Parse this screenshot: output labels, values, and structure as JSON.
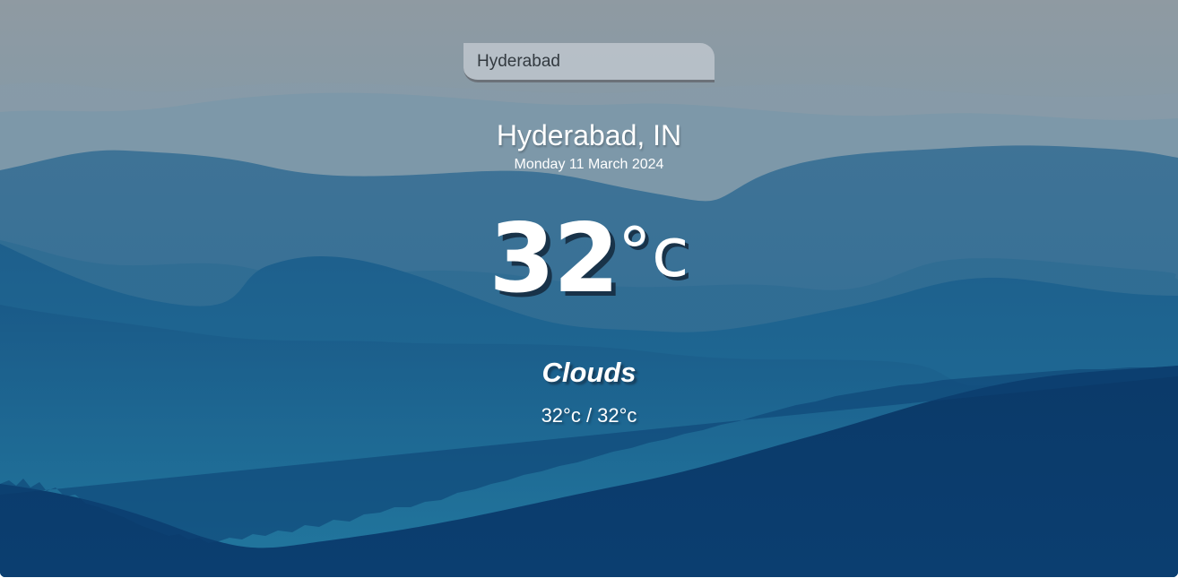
{
  "search": {
    "value": "Hyderabad"
  },
  "location": {
    "name": "Hyderabad, IN",
    "date": "Monday 11 March 2024"
  },
  "weather": {
    "temperature": "32",
    "unit": "°c",
    "condition": "Clouds",
    "hi_low": "32°c / 32°c"
  },
  "colors": {
    "sky_top": "#8d9aa3",
    "ridge_mid": "#3d7aa0",
    "valley": "#1d6a94",
    "foreground": "#0b3c6d"
  }
}
